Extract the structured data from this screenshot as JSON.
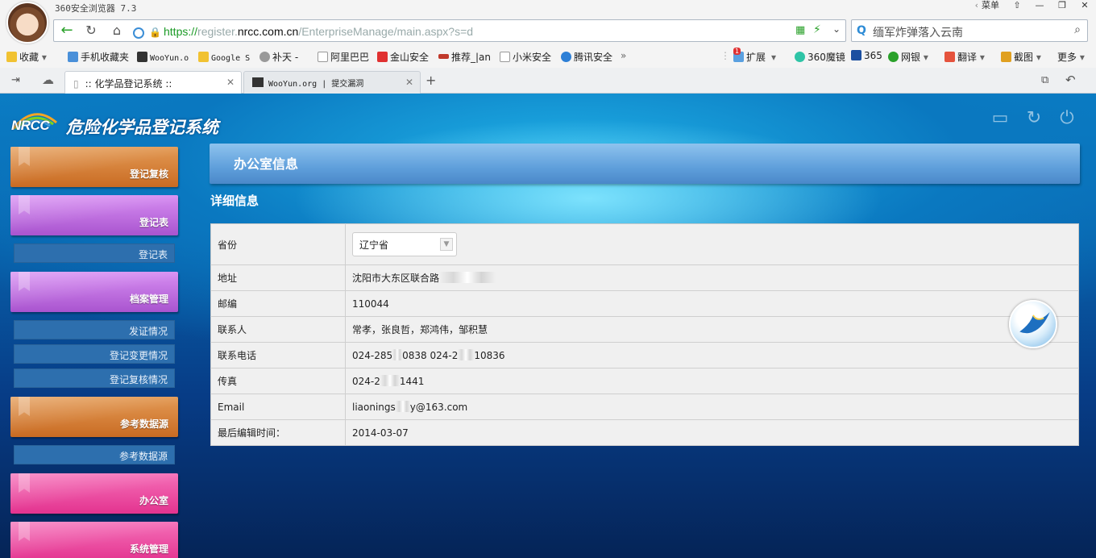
{
  "browser": {
    "app_title": "360安全浏览器 7.3",
    "menu_label": "菜单",
    "url_https": "https://",
    "url_pre": "register.",
    "url_host": "nrcc.com.cn",
    "url_path": "/EnterpriseManage/main.aspx?s=d",
    "search_text": "缅军炸弹落入云南",
    "bookmarks": [
      "收藏",
      "手机收藏夹",
      "WooYun.o",
      "Google S",
      "补天 -",
      "阿里巴巴",
      "金山安全",
      "推荐_|an",
      "小米安全",
      "腾讯安全"
    ],
    "extensions": [
      "扩展",
      "360魔镜",
      "365",
      "网银",
      "翻译",
      "截图",
      "更多"
    ],
    "ext_badge": "1",
    "tabs": [
      {
        "label": ":: 化学品登记系统 ::"
      },
      {
        "label": "WooYun.org | 提交漏洞"
      }
    ],
    "colors": {
      "https": "#1a9a25",
      "accent": "#3b8ed6"
    }
  },
  "page": {
    "logo_abbr": "NRCC",
    "system_title": "危险化学品登记系统",
    "sidebar": {
      "sections": [
        {
          "label": "登记复核",
          "color": "orange"
        },
        {
          "label": "登记表",
          "color": "purple",
          "sub": [
            "登记表"
          ]
        },
        {
          "label": "档案管理",
          "color": "purple",
          "sub": [
            "发证情况",
            "登记变更情况",
            "登记复核情况"
          ]
        },
        {
          "label": "参考数据源",
          "color": "orange",
          "sub": [
            "参考数据源"
          ]
        },
        {
          "label": "办公室",
          "color": "pink"
        },
        {
          "label": "系统管理",
          "color": "pink"
        }
      ]
    },
    "panel_title": "办公室信息",
    "detail_title": "详细信息",
    "fields": {
      "province_label": "省份",
      "province_value": "辽宁省",
      "address_label": "地址",
      "address_value": "沈阳市大东区联合路",
      "postcode_label": "邮编",
      "postcode_value": "110044",
      "contact_label": "联系人",
      "contact_value": "常孝，张良哲，郑鸿伟，邹积慧",
      "phone_label": "联系电话",
      "phone_part1": "024-285",
      "phone_part2": "0838 024-2",
      "phone_part3": "10836",
      "fax_label": "传真",
      "fax_part1": "024-2",
      "fax_part2": "1441",
      "email_label": "Email",
      "email_part1": "liaonings",
      "email_part2": "y@163.com",
      "updated_label": "最后编辑时间：",
      "updated_value": "2014-03-07"
    }
  }
}
